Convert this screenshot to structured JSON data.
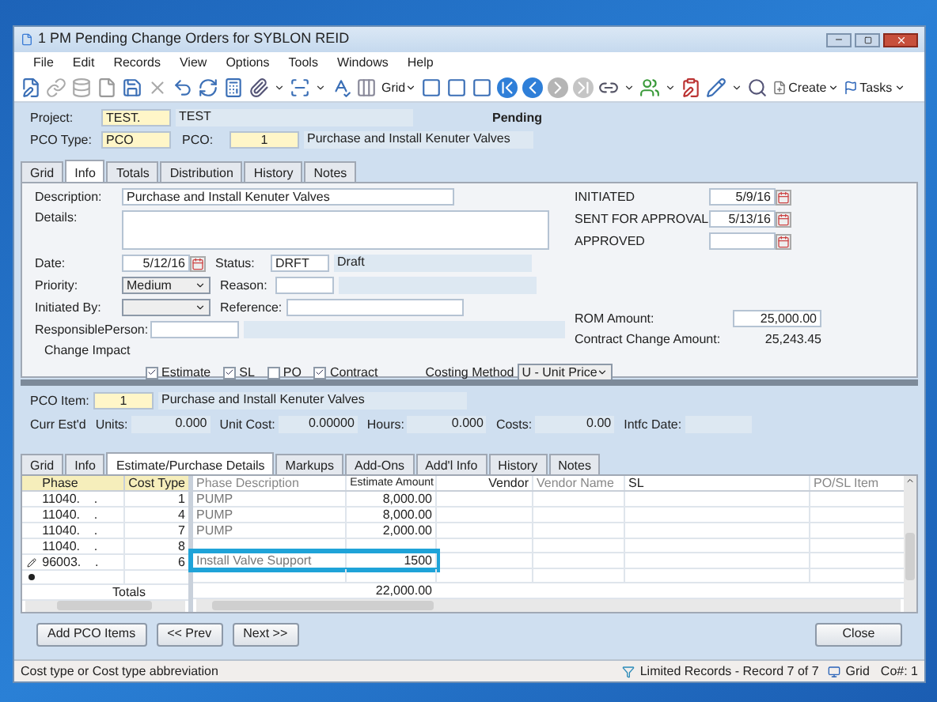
{
  "window": {
    "title": "1 PM Pending Change Orders for SYBLON REID"
  },
  "menu": [
    "File",
    "Edit",
    "Records",
    "View",
    "Options",
    "Tools",
    "Windows",
    "Help"
  ],
  "toolbar": {
    "grid": "Grid",
    "create": "Create",
    "tasks": "Tasks"
  },
  "header": {
    "project_label": "Project:",
    "project": "TEST.",
    "project_name": "TEST",
    "status": "Pending",
    "pco_type_label": "PCO Type:",
    "pco_type": "PCO",
    "pco_label": "PCO:",
    "pco": "1",
    "pco_desc": "Purchase and Install Kenuter Valves"
  },
  "tabs": [
    {
      "label": "Grid",
      "selected": false
    },
    {
      "label": "Info",
      "selected": true
    },
    {
      "label": "Totals",
      "selected": false
    },
    {
      "label": "Distribution",
      "selected": false
    },
    {
      "label": "History",
      "selected": false
    },
    {
      "label": "Notes",
      "selected": false
    }
  ],
  "info": {
    "description_label": "Description:",
    "description": "Purchase and Install Kenuter Valves",
    "details_label": "Details:",
    "date_label": "Date:",
    "date": "5/12/16",
    "status_label": "Status:",
    "status_code": "DRFT",
    "status_name": "Draft",
    "priority_label": "Priority:",
    "priority": "Medium",
    "reason_label": "Reason:",
    "initiated_by_label": "Initiated By:",
    "reference_label": "Reference:",
    "responsible_label": "ResponsiblePerson:",
    "change_impact_label": "Change Impact",
    "impacts": [
      {
        "label": "Estimate",
        "checked": true
      },
      {
        "label": "SL",
        "checked": true
      },
      {
        "label": "PO",
        "checked": false
      },
      {
        "label": "Contract",
        "checked": true
      }
    ],
    "costing_label": "Costing Method",
    "costing": "U - Unit Price",
    "dates": [
      {
        "label": "INITIATED",
        "value": "5/9/16"
      },
      {
        "label": "SENT FOR APPROVAL",
        "value": "5/13/16"
      },
      {
        "label": "APPROVED"
      }
    ],
    "rom_label": "ROM Amount:",
    "rom": "25,000.00",
    "contract_change_label": "Contract Change Amount:",
    "contract_change": "25,243.45"
  },
  "item": {
    "label": "PCO Item:",
    "number": "1",
    "description": "Purchase and Install Kenuter Valves",
    "curr_label": "Curr Est'd",
    "stats": [
      {
        "label": "Units:",
        "value": "0.000"
      },
      {
        "label": "Unit Cost:",
        "value": "0.00000"
      },
      {
        "label": "Hours:",
        "value": "0.000"
      },
      {
        "label": "Costs:",
        "value": "0.00"
      }
    ],
    "intfc_label": "Intfc Date:"
  },
  "item_tabs": [
    {
      "label": "Grid",
      "selected": false
    },
    {
      "label": "Info",
      "selected": false
    },
    {
      "label": "Estimate/Purchase Details",
      "selected": true
    },
    {
      "label": "Markups",
      "selected": false
    },
    {
      "label": "Add-Ons",
      "selected": false
    },
    {
      "label": "Add'l Info",
      "selected": false
    },
    {
      "label": "History",
      "selected": false
    },
    {
      "label": "Notes",
      "selected": false
    }
  ],
  "grid": {
    "columns": [
      "Phase",
      "Cost Type",
      "Phase Description",
      "Estimate Amount",
      "Vendor",
      "Vendor Name",
      "SL",
      "PO/SL Item"
    ],
    "rows": [
      {
        "kind": "data",
        "editing": false,
        "cells": [
          "11040.    .",
          "1",
          "PUMP",
          "8,000.00"
        ]
      },
      {
        "kind": "data",
        "editing": false,
        "cells": [
          "11040.    .",
          "4",
          "PUMP",
          "8,000.00"
        ]
      },
      {
        "kind": "data",
        "editing": false,
        "cells": [
          "11040.    .",
          "7",
          "PUMP",
          "2,000.00"
        ]
      },
      {
        "kind": "data",
        "editing": false,
        "cells": [
          "11040.    .",
          "8"
        ]
      },
      {
        "kind": "data",
        "editing": true,
        "cells": [
          "96003.    .",
          "6",
          "Install Valve Support",
          "1500"
        ]
      },
      {
        "kind": "new",
        "editing": false,
        "cells": []
      }
    ],
    "totals_label": "Totals",
    "total": "22,000.00"
  },
  "buttons": {
    "add": "Add PCO Items",
    "prev": "<< Prev",
    "next": "Next >>",
    "close": "Close"
  },
  "status_bar": {
    "hint": "Cost type or Cost type abbreviation",
    "records": "Limited Records - Record 7 of 7",
    "view": "Grid",
    "company": "Co#: 1"
  }
}
